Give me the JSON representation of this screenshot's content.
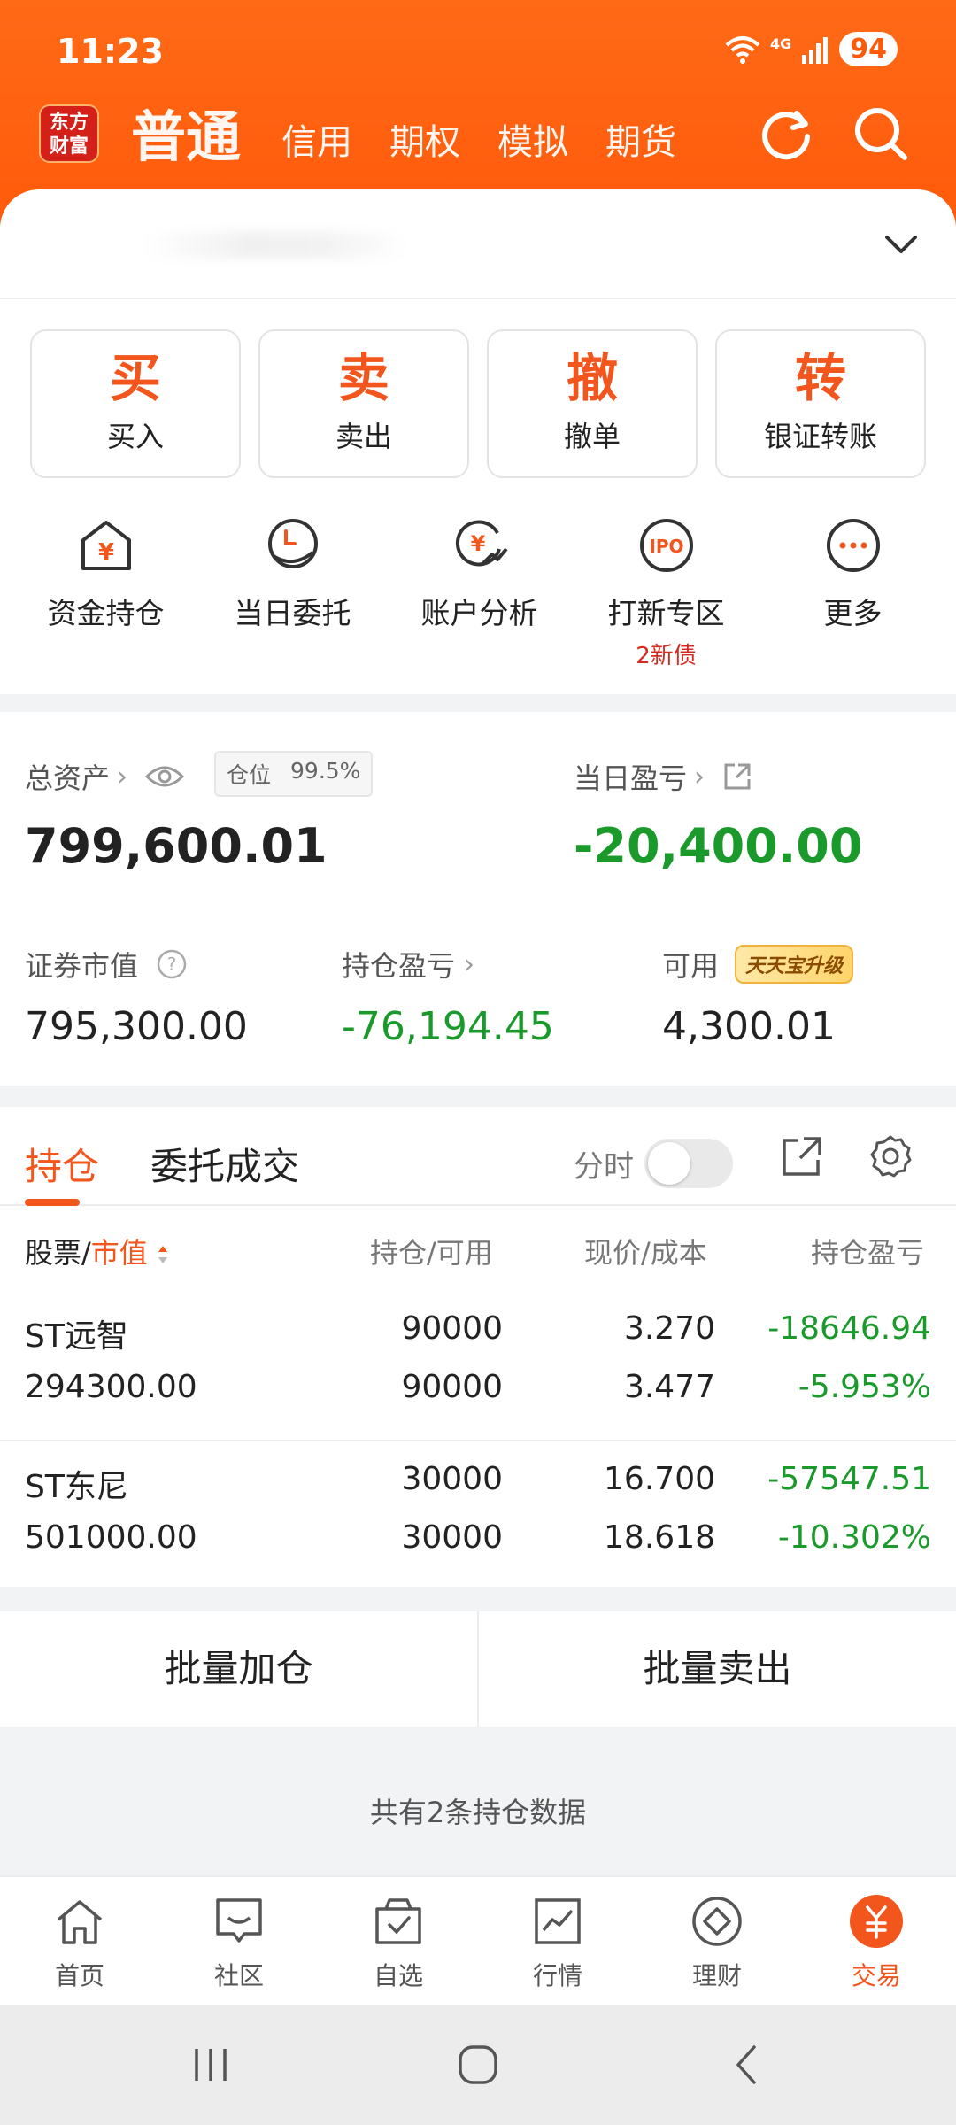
{
  "status": {
    "time": "11:23",
    "network": "4G",
    "wifi_level": "5",
    "battery": "94"
  },
  "header": {
    "logo_line1": "东方",
    "logo_line2": "财富",
    "tabs": [
      "普通",
      "信用",
      "期权",
      "模拟",
      "期货"
    ],
    "active_tab": "普通"
  },
  "actions": [
    {
      "char": "买",
      "label": "买入"
    },
    {
      "char": "卖",
      "label": "卖出"
    },
    {
      "char": "撤",
      "label": "撤单"
    },
    {
      "char": "转",
      "label": "银证转账"
    }
  ],
  "quick": [
    {
      "icon": "funds-house-icon",
      "label": "资金持仓",
      "sub": ""
    },
    {
      "icon": "daily-order-icon",
      "label": "当日委托",
      "sub": ""
    },
    {
      "icon": "account-analysis-icon",
      "label": "账户分析",
      "sub": ""
    },
    {
      "icon": "ipo-icon",
      "label": "打新专区",
      "sub": "2新债"
    },
    {
      "icon": "more-icon",
      "label": "更多",
      "sub": ""
    }
  ],
  "assets": {
    "total_label": "总资产",
    "position_label": "仓位",
    "position_value": "99.5%",
    "total_value": "799,600.01",
    "day_pl_label": "当日盈亏",
    "day_pl_value": "-20,400.00",
    "market_value_label": "证券市值",
    "market_value": "795,300.00",
    "holding_pl_label": "持仓盈亏",
    "holding_pl": "-76,194.45",
    "available_label": "可用",
    "available_badge": "天天宝升级",
    "available": "4,300.01"
  },
  "holdings": {
    "tabs": [
      "持仓",
      "委托成交"
    ],
    "fenshi_label": "分时",
    "headers": {
      "stock_prefix": "股票/",
      "stock_sort": "市值",
      "position": "持仓/可用",
      "price": "现价/成本",
      "pl": "持仓盈亏"
    },
    "rows": [
      {
        "name": "ST远智",
        "market_value": "294300.00",
        "position": "90000",
        "available": "90000",
        "price": "3.270",
        "cost": "3.477",
        "pl": "-18646.94",
        "pl_pct": "-5.953%"
      },
      {
        "name": "ST东尼",
        "market_value": "501000.00",
        "position": "30000",
        "available": "30000",
        "price": "16.700",
        "cost": "18.618",
        "pl": "-57547.51",
        "pl_pct": "-10.302%"
      }
    ]
  },
  "batch": {
    "add": "批量加仓",
    "sell": "批量卖出"
  },
  "footer_note": "共有2条持仓数据",
  "bottom_nav": [
    {
      "icon": "home-icon",
      "label": "首页"
    },
    {
      "icon": "community-icon",
      "label": "社区"
    },
    {
      "icon": "watchlist-icon",
      "label": "自选"
    },
    {
      "icon": "market-icon",
      "label": "行情"
    },
    {
      "icon": "wealth-icon",
      "label": "理财"
    },
    {
      "icon": "trade-icon",
      "label": "交易"
    }
  ],
  "colors": {
    "brand": "#ff5a0a",
    "accent": "#f2561d",
    "down_green": "#1b9a2c",
    "highlight_red": "#d52a20"
  }
}
